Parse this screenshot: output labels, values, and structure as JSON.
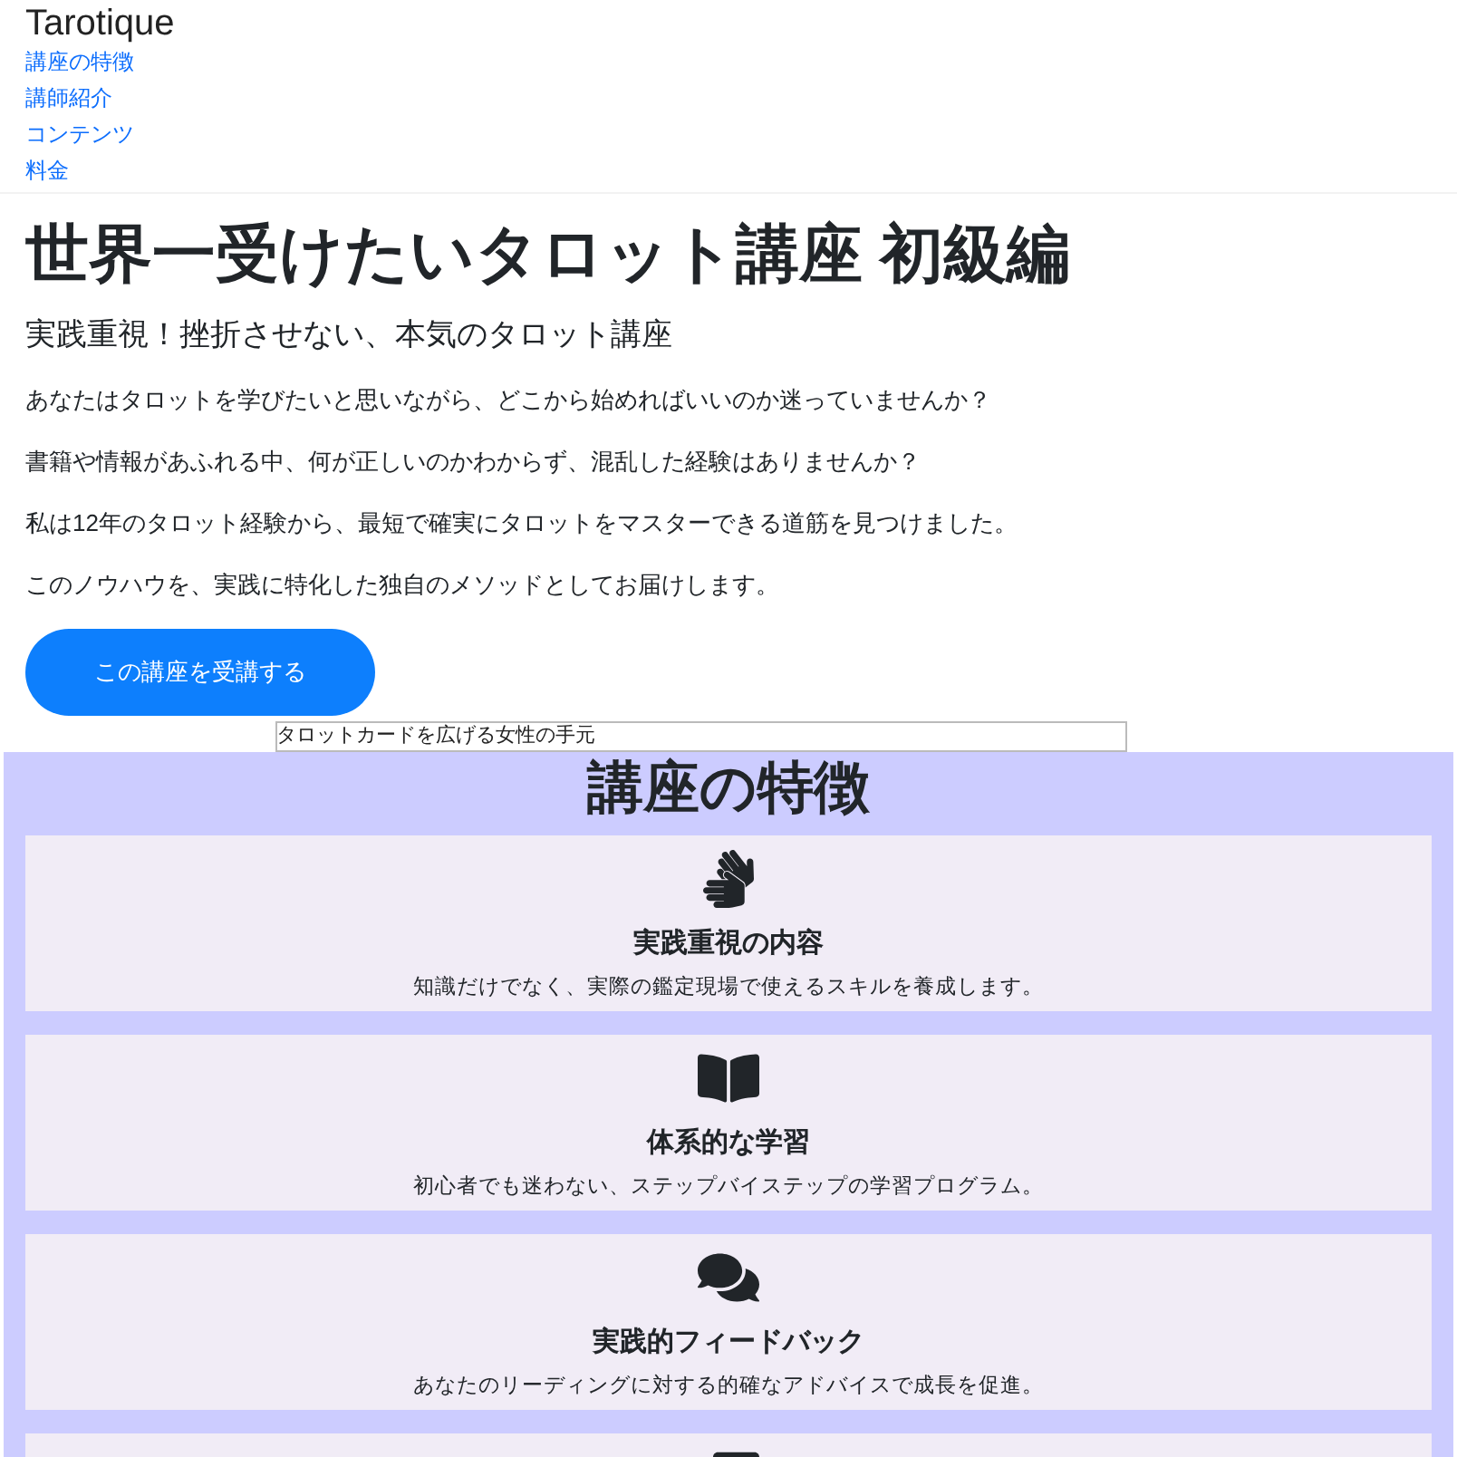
{
  "header": {
    "brand": "Tarotique",
    "nav": [
      "講座の特徴",
      "講師紹介",
      "コンテンツ",
      "料金"
    ]
  },
  "hero": {
    "title": "世界一受けたいタロット講座 初級編",
    "subtitle": "実践重視！挫折させない、本気のタロット講座",
    "paragraphs": [
      "あなたはタロットを学びたいと思いながら、どこから始めればいいのか迷っていませんか？",
      "書籍や情報があふれる中、何が正しいのかわからず、混乱した経験はありませんか？",
      "私は12年のタロット経験から、最短で確実にタロットをマスターできる道筋を見つけました。",
      "このノウハウを、実践に特化した独自のメソッドとしてお届けします。"
    ],
    "button": "この講座を受講する",
    "image_alt": "タロットカードを広げる女性の手元"
  },
  "features": {
    "title": "講座の特徴",
    "items": [
      {
        "title": "実践重視の内容",
        "text": "知識だけでなく、実際の鑑定現場で使えるスキルを養成します。"
      },
      {
        "title": "体系的な学習",
        "text": "初心者でも迷わない、ステップバイステップの学習プログラム。"
      },
      {
        "title": "実践的フィードバック",
        "text": "あなたのリーディングに対する的確なアドバイスで成長を促進。"
      }
    ]
  }
}
